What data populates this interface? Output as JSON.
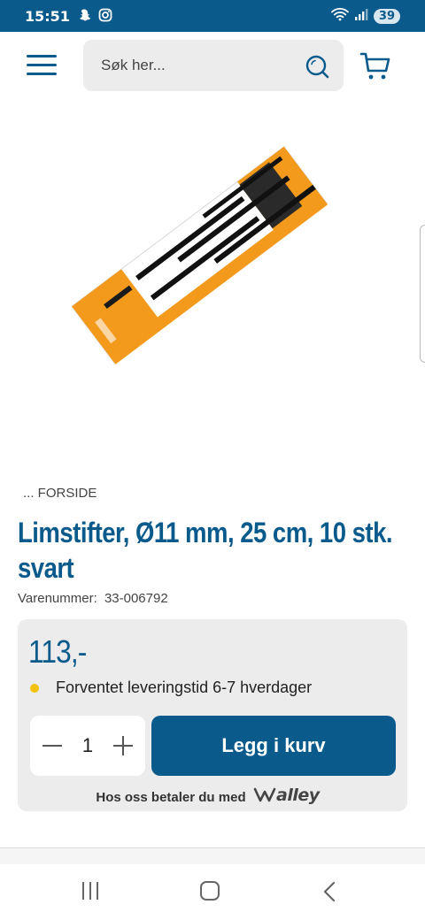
{
  "status_bar": {
    "time": "15:51",
    "battery": "39",
    "icons": [
      "snapchat-icon",
      "instagram-icon",
      "wifi-icon",
      "signal-icon"
    ]
  },
  "header": {
    "search_placeholder": "Søk her...",
    "icons": [
      "menu-icon",
      "search-icon",
      "cart-icon"
    ]
  },
  "product_image": {
    "alt": "Limstifter"
  },
  "breadcrumb": {
    "text": "... FORSIDE"
  },
  "product": {
    "title": "Limstifter, Ø11 mm, 25 cm, 10 stk. svart",
    "sku_label": "Varenummer:",
    "sku": "33-006792"
  },
  "purchase": {
    "price": "113,-",
    "delivery": "Forventet leveringstid 6-7 hverdager",
    "quantity": "1",
    "add_to_cart": "Legg i kurv",
    "pay_with": "Hos oss betaler du med",
    "payment_brand": "Walley"
  },
  "colors": {
    "primary": "#0a5a8c",
    "panel": "#ececed",
    "delivery_dot": "#f2c200",
    "package_orange": "#f39a1c"
  },
  "nav_bar": {
    "icons": [
      "recent-apps-icon",
      "home-icon",
      "back-icon"
    ]
  }
}
